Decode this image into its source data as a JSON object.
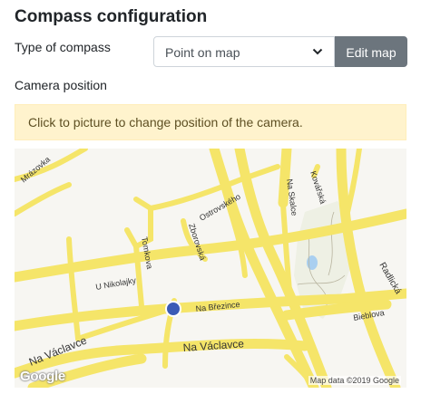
{
  "title": "Compass configuration",
  "compass_type": {
    "label": "Type of compass",
    "selected": "Point on map",
    "edit_button": "Edit map"
  },
  "camera": {
    "label": "Camera position",
    "alert": "Click to picture to change position of the camera."
  },
  "map": {
    "streets": [
      "Mrázovka",
      "Ostrovského",
      "Zborovská",
      "Tomkova",
      "Na Skalce",
      "Kovářská",
      "U Nikolajky",
      "Na Březince",
      "Na Václavce",
      "Na Václavce",
      "Bieblova",
      "Radlická"
    ],
    "logo": "Google",
    "attribution": "Map data ©2019 Google",
    "road_color": "#f5e569",
    "background_color": "#f7f6f2",
    "marker_color": "#3b5bb6"
  }
}
